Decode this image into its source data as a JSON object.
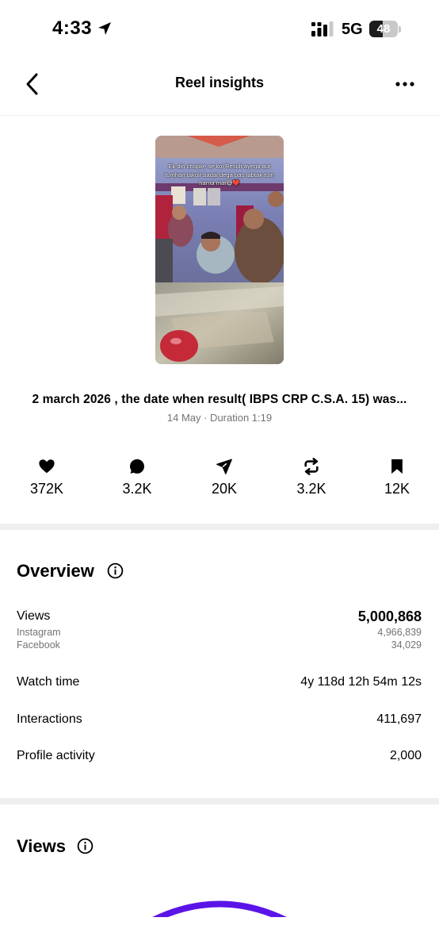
{
  "status_bar": {
    "time": "4:33",
    "network": "5G",
    "battery": "48",
    "battery_level": 0.48
  },
  "header": {
    "title": "Reel insights"
  },
  "reel": {
    "overlay_text": "Ek din chupke se koi Result ayega aur tumhari takdir badal dega bas tabtak tum harna mat😅❤️",
    "caption": "2 march 2026 , the date when result( IBPS CRP C.S.A. 15)  was...",
    "meta": "14 May · Duration 1:19"
  },
  "stats": {
    "likes": "372K",
    "comments": "3.2K",
    "shares": "20K",
    "reposts": "3.2K",
    "saves": "12K"
  },
  "overview": {
    "title": "Overview",
    "views_label": "Views",
    "views_total": "5,000,868",
    "instagram_label": "Instagram",
    "instagram_value": "4,966,839",
    "facebook_label": "Facebook",
    "facebook_value": "34,029",
    "watch_time_label": "Watch time",
    "watch_time_value": "4y 118d 12h 54m 12s",
    "interactions_label": "Interactions",
    "interactions_value": "411,697",
    "profile_activity_label": "Profile activity",
    "profile_activity_value": "2,000"
  },
  "views_section": {
    "title": "Views"
  },
  "colors": {
    "accent_ring": "#5b14e8",
    "muted_text": "#737373",
    "divider": "#efeff1"
  },
  "icons": [
    "location-arrow-icon",
    "signal-icon",
    "battery-icon",
    "back-arrow-icon",
    "more-icon",
    "heart-icon",
    "comment-icon",
    "share-icon",
    "repost-icon",
    "save-icon",
    "info-icon"
  ]
}
